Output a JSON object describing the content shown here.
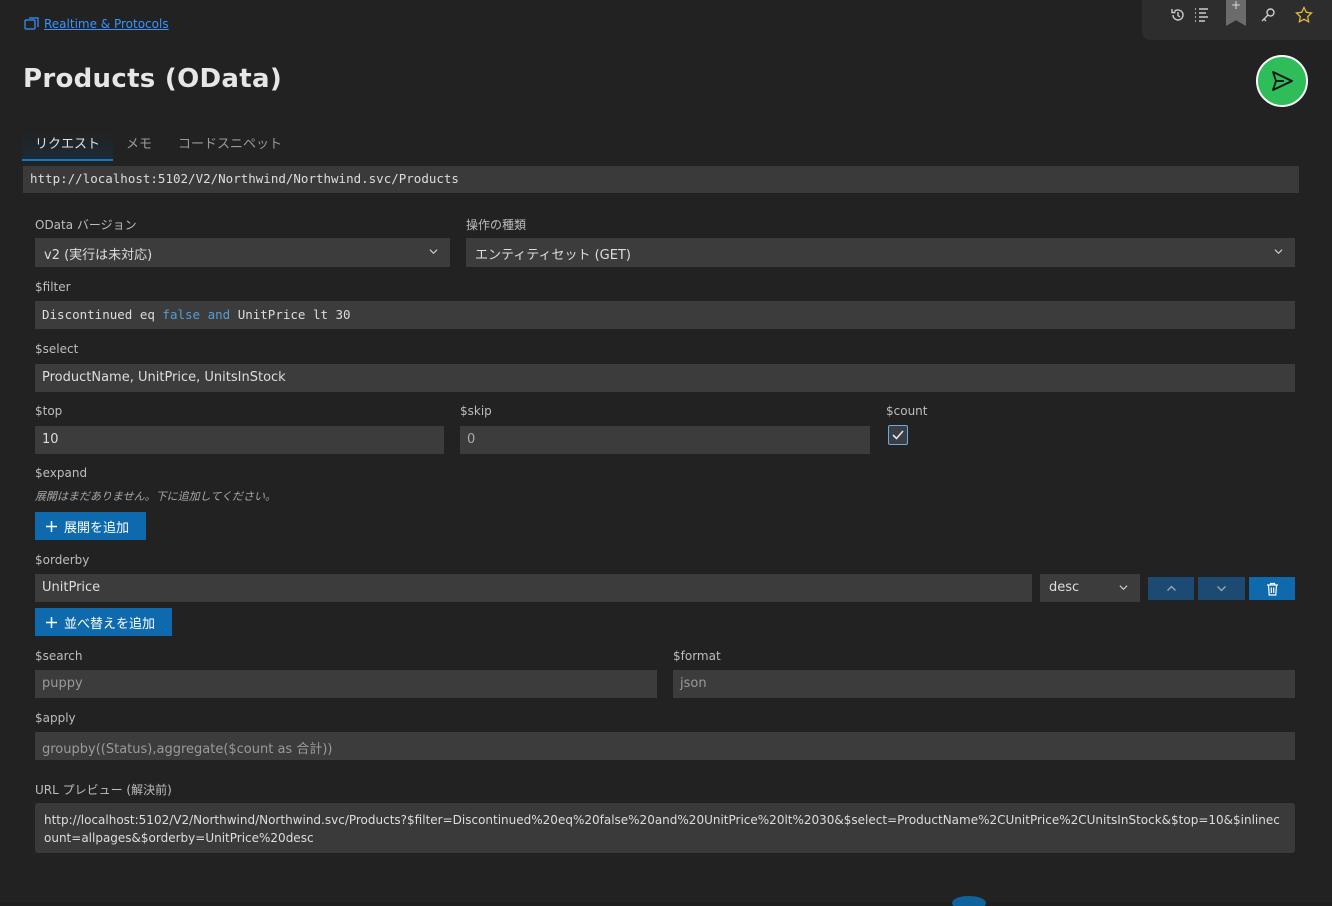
{
  "breadcrumb": {
    "label": "Realtime & Protocols"
  },
  "title": "Products (OData)",
  "tabs": [
    {
      "label": "リクエスト",
      "active": true
    },
    {
      "label": "メモ"
    },
    {
      "label": "コードスニペット"
    }
  ],
  "url": "http://localhost:5102/V2/Northwind/Northwind.svc/Products",
  "odata_version": {
    "label": "OData バージョン",
    "value": "v2 (実行は未対応)"
  },
  "operation": {
    "label": "操作の種類",
    "value": "エンティティセット (GET)"
  },
  "filter": {
    "label": "$filter",
    "tokens": [
      "Discontinued eq ",
      "false",
      " ",
      "and",
      " UnitPrice lt 30"
    ]
  },
  "select": {
    "label": "$select",
    "value": "ProductName, UnitPrice, UnitsInStock"
  },
  "top": {
    "label": "$top",
    "value": "10"
  },
  "skip": {
    "label": "$skip",
    "value": "0"
  },
  "count": {
    "label": "$count",
    "checked": true
  },
  "expand": {
    "label": "$expand",
    "hint": "展開はまだありません。下に追加してください。",
    "add_label": "展開を追加"
  },
  "orderby": {
    "label": "$orderby",
    "field": "UnitPrice",
    "direction": "desc",
    "add_label": "並べ替えを追加"
  },
  "search": {
    "label": "$search",
    "placeholder": "puppy"
  },
  "format": {
    "label": "$format",
    "placeholder": "json"
  },
  "apply": {
    "label": "$apply",
    "placeholder": "groupby((Status),aggregate($count as 合計))"
  },
  "preview": {
    "label": "URL プレビュー (解決前)",
    "value": "http://localhost:5102/V2/Northwind/Northwind.svc/Products?$filter=Discontinued%20eq%20false%20and%20UnitPrice%20lt%2030&$select=ProductName%2CUnitPrice%2CUnitsInStock&$top=10&$inlinecount=allpages&$orderby=UnitPrice%20desc"
  },
  "colors": {
    "accent": "#0e6aad",
    "send": "#2ebd59",
    "background": "#222222",
    "field": "#3c3c3c",
    "keyword": "#569cd6"
  },
  "icons": [
    "collection-icon",
    "history-icon",
    "list-icon",
    "bookmark-icon",
    "key-icon",
    "star-icon",
    "send-icon",
    "chevron-down-icon",
    "plus-icon",
    "chevron-up-icon",
    "trash-icon",
    "check-icon"
  ]
}
